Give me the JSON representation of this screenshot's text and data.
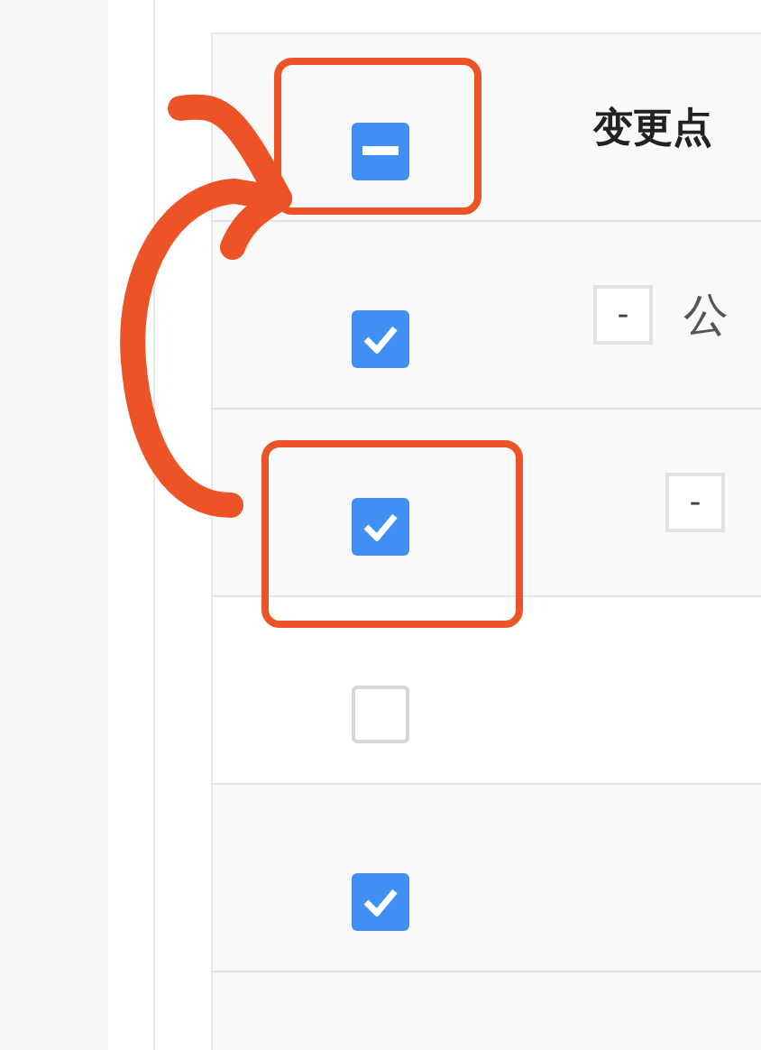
{
  "table": {
    "header": {
      "checkbox": {
        "checked": true,
        "indeterminate": true
      },
      "column_2": "变更点"
    },
    "rows": [
      {
        "checked": true,
        "toggle": "-",
        "label": "公",
        "children": [
          {
            "checked": true,
            "toggle": "-",
            "children": [
              {
                "checked": false
              },
              {
                "checked": true
              }
            ]
          }
        ]
      }
    ]
  }
}
